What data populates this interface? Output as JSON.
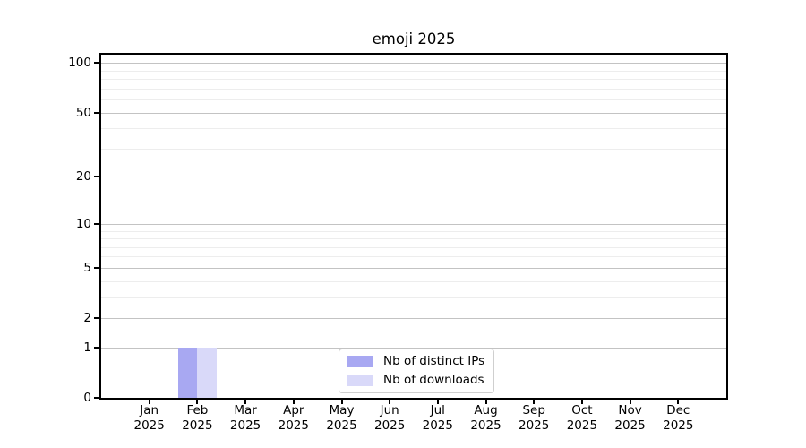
{
  "title": "emoji 2025",
  "chart_data": {
    "type": "bar",
    "title": "emoji 2025",
    "categories": [
      "Jan 2025",
      "Feb 2025",
      "Mar 2025",
      "Apr 2025",
      "May 2025",
      "Jun 2025",
      "Jul 2025",
      "Aug 2025",
      "Sep 2025",
      "Oct 2025",
      "Nov 2025",
      "Dec 2025"
    ],
    "series": [
      {
        "name": "Nb of distinct IPs",
        "color": "#a8a8f2",
        "values": [
          0,
          1,
          0,
          0,
          0,
          0,
          0,
          0,
          0,
          0,
          0,
          0
        ]
      },
      {
        "name": "Nb of downloads",
        "color": "#d9d9f9",
        "values": [
          0,
          1,
          0,
          0,
          0,
          0,
          0,
          0,
          0,
          0,
          0,
          0
        ]
      }
    ],
    "xlabel": "",
    "ylabel": "",
    "y_scale": "log10(value+1)",
    "y_ticks": [
      0,
      1,
      2,
      5,
      10,
      20,
      50,
      100
    ],
    "y_minor_gridlines": [
      3,
      4,
      6,
      7,
      8,
      9,
      30,
      40,
      60,
      70,
      80,
      90
    ],
    "ylim": [
      0,
      112
    ],
    "grid": true,
    "legend_position": "lower center",
    "bar_grouping": "paired around month tick"
  }
}
